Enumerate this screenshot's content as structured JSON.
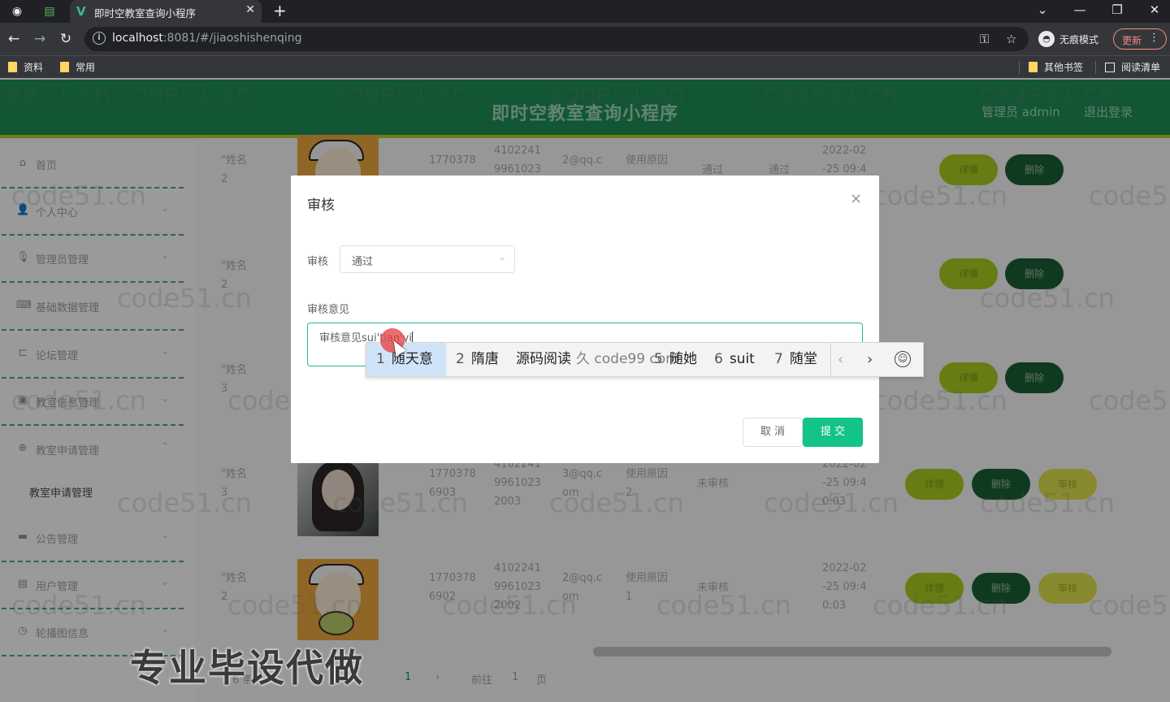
{
  "browser": {
    "tab_title": "即时空教室查询小程序",
    "tab_favicon": "V",
    "url_host": "localhost",
    "url_rest": ":8081/#/jiaoshishenqing",
    "incognito_label": "无痕模式",
    "update_label": "更新",
    "bookmarks": [
      "资料",
      "常用"
    ],
    "bookmarks_right": [
      "其他书签",
      "阅读清单"
    ]
  },
  "header": {
    "title": "即时空教室查询小程序",
    "admin": "管理员 admin",
    "logout": "退出登录"
  },
  "sidebar": {
    "items": [
      {
        "label": "首页",
        "icon": "home-icon",
        "glyph": "⌂",
        "arrow": ""
      },
      {
        "label": "个人中心",
        "icon": "user-icon",
        "glyph": "👤",
        "arrow": "⌄"
      },
      {
        "label": "管理员管理",
        "icon": "mic-icon",
        "glyph": "🎙",
        "arrow": "⌄"
      },
      {
        "label": "基础数据管理",
        "icon": "keyboard-icon",
        "glyph": "⌨",
        "arrow": "⌄"
      },
      {
        "label": "论坛管理",
        "icon": "crop-icon",
        "glyph": "⊏",
        "arrow": "⌄"
      },
      {
        "label": "教室信息管理",
        "icon": "message-icon",
        "glyph": "▣",
        "arrow": "⌄"
      },
      {
        "label": "教室申请管理",
        "icon": "globe-icon",
        "glyph": "⊕",
        "arrow": "⌃"
      }
    ],
    "sub_item": "教室申请管理",
    "items_after": [
      {
        "label": "公告管理",
        "icon": "ticket-icon",
        "glyph": "▬",
        "arrow": "⌄"
      },
      {
        "label": "用户管理",
        "icon": "printer-icon",
        "glyph": "▤",
        "arrow": "⌄"
      },
      {
        "label": "轮播图信息",
        "icon": "clock-icon",
        "glyph": "◷",
        "arrow": "⌄"
      }
    ]
  },
  "table": {
    "rows": [
      {
        "name": "\"姓名\n2",
        "phone": "1770378",
        "idcard": "4102241\n9961023",
        "email": "2@qq.c",
        "reason": "使用原因",
        "status": "通过",
        "status2": "通过",
        "time": "2022-02\n-25 09:4",
        "avatar": "orange",
        "has_audit": false
      },
      {
        "name": "\"姓名\n2",
        "phone": "",
        "idcard": "",
        "email": "",
        "reason": "",
        "status": "",
        "status2": "",
        "time": "",
        "avatar": "none",
        "has_audit": false
      },
      {
        "name": "\"姓名\n3",
        "phone": "",
        "idcard": "",
        "email": "",
        "reason": "",
        "status": "",
        "status2": "",
        "time": "",
        "avatar": "none",
        "has_audit": false
      },
      {
        "name": "\"姓名\n3",
        "phone": "1770378\n6903",
        "idcard": "4102241\n9961023\n2003",
        "email": "3@qq.c\nom",
        "reason": "使用原因\n2",
        "status": "未审核",
        "status2": "",
        "time": "2022-02\n-25 09:4\n0:03",
        "avatar": "photo",
        "has_audit": true
      },
      {
        "name": "\"姓名\n2",
        "phone": "1770378\n6902",
        "idcard": "4102241\n9961023\n2002",
        "email": "2@qq.c\nom",
        "reason": "使用原因\n1",
        "status": "未审核",
        "status2": "",
        "time": "2022-02\n-25 09:4\n0:03",
        "avatar": "orange",
        "has_audit": true
      }
    ],
    "btn_detail": "详情",
    "btn_delete": "删除",
    "btn_audit": "审核"
  },
  "pager": {
    "prefix": "6 条",
    "page": "1",
    "goto": "前往",
    "goto_value": "1",
    "page_unit": "页"
  },
  "watermark": "code51.cn",
  "promo": "专业毕设代做",
  "dialog": {
    "title": "审核",
    "audit_label": "审核",
    "audit_value": "通过",
    "opinion_label": "审核意见",
    "opinion_value": "审核意见sui'tian'yi",
    "cancel": "取 消",
    "submit": "提 交"
  },
  "ime": {
    "candidates": [
      {
        "num": "1",
        "text": "随天意"
      },
      {
        "num": "2",
        "text": "隋唐"
      },
      {
        "num": "3",
        "text": "源码阅读"
      },
      {
        "num": "4",
        "text": "随她"
      },
      {
        "num": "5",
        "text": "随她"
      },
      {
        "num": "6",
        "text": "suit"
      },
      {
        "num": "7",
        "text": "随堂"
      }
    ],
    "overlap_text": "久 code99 com"
  }
}
